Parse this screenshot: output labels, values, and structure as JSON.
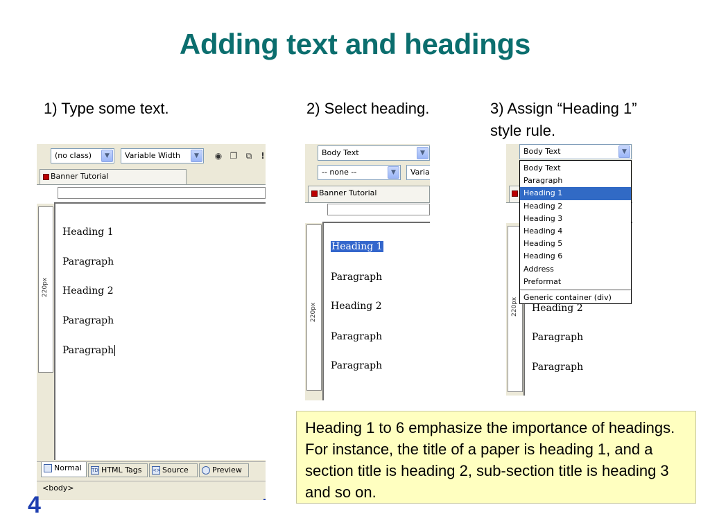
{
  "title": "Adding text and headings",
  "steps": {
    "s1": "1) Type some text.",
    "s2": "2) Select heading.",
    "s3_line1": "3) Assign “Heading 1”",
    "s3_line2": "style rule."
  },
  "note": "Heading 1 to 6 emphasize the importance of headings. For instance, the title of a paper is heading 1, and a section title is heading 2, sub-section title is heading 3 and so on.",
  "page_number": "4",
  "shot1": {
    "class_select": "(no class)",
    "width_select": "Variable Width",
    "tab_label": "Banner Tutorial",
    "ruler_label": "220px",
    "lines": [
      "Heading 1",
      "Paragraph",
      "Heading 2",
      "Paragraph",
      "Paragraph"
    ],
    "bottom_tabs": [
      "Normal",
      "HTML Tags",
      "Source",
      "Preview"
    ],
    "status": "<body>"
  },
  "shot2": {
    "format_select": "Body Text",
    "style_select": "-- none --",
    "width_select_partial": "Variat",
    "tab_label": "Banner Tutorial",
    "ruler_label": "220px",
    "lines": [
      "Heading 1",
      "Paragraph",
      "Heading 2",
      "Paragraph",
      "Paragraph"
    ]
  },
  "shot3": {
    "format_select": "Body Text",
    "ruler_label": "220px",
    "dropdown_options": [
      "Body Text",
      "Paragraph",
      "Heading 1",
      "Heading 2",
      "Heading 3",
      "Heading 4",
      "Heading 5",
      "Heading 6",
      "Address",
      "Preformat"
    ],
    "dropdown_extra": "Generic container (div)",
    "highlighted": "Heading 1",
    "lines": [
      "Heading 2",
      "Paragraph",
      "Paragraph"
    ]
  }
}
